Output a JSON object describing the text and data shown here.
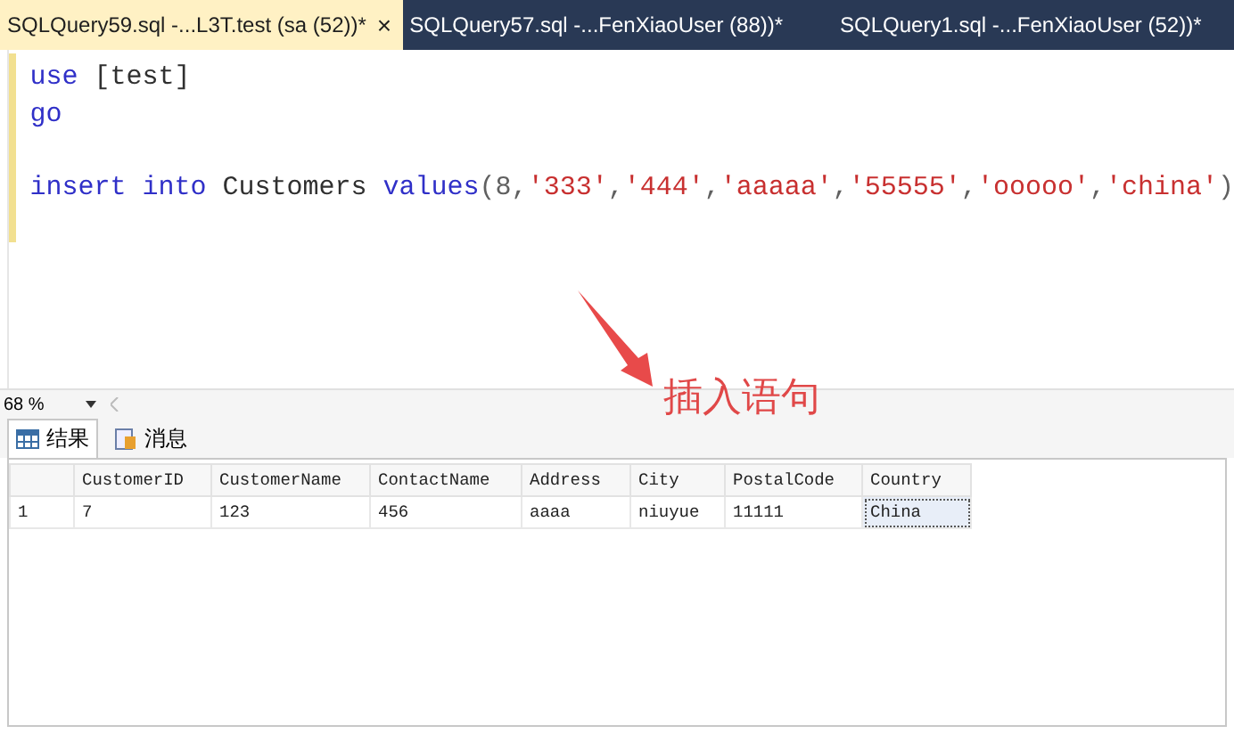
{
  "tabs": [
    {
      "label": "SQLQuery59.sql -...L3T.test (sa (52))*",
      "selected": true,
      "close": "×"
    },
    {
      "label": "SQLQuery57.sql -...FenXiaoUser (88))*",
      "selected": false
    },
    {
      "label": "SQLQuery1.sql -...FenXiaoUser (52))*",
      "selected": false
    }
  ],
  "editor": {
    "lines": [
      {
        "kind": "code",
        "tokens": [
          {
            "text": "use",
            "kind": "keyword"
          },
          {
            "text": " [test]",
            "kind": "plain"
          }
        ]
      },
      {
        "kind": "code",
        "tokens": [
          {
            "text": "go",
            "kind": "keyword"
          }
        ]
      },
      {
        "kind": "blank"
      },
      {
        "kind": "code",
        "tokens": [
          {
            "text": "insert",
            "kind": "keyword"
          },
          {
            "text": " into",
            "kind": "keyword"
          },
          {
            "text": " Customers ",
            "kind": "plain"
          },
          {
            "text": "values",
            "kind": "keyword"
          },
          {
            "text": "(8,",
            "kind": "punct"
          },
          {
            "text": "'333'",
            "kind": "string"
          },
          {
            "text": ",",
            "kind": "punct"
          },
          {
            "text": "'444'",
            "kind": "string"
          },
          {
            "text": ",",
            "kind": "punct"
          },
          {
            "text": "'aaaaa'",
            "kind": "string"
          },
          {
            "text": ",",
            "kind": "punct"
          },
          {
            "text": "'55555'",
            "kind": "string"
          },
          {
            "text": ",",
            "kind": "punct"
          },
          {
            "text": "'ooooo'",
            "kind": "string"
          },
          {
            "text": ",",
            "kind": "punct"
          },
          {
            "text": "'china'",
            "kind": "string"
          },
          {
            "text": ")",
            "kind": "punct"
          }
        ]
      }
    ]
  },
  "annotation": {
    "text": "插入语句"
  },
  "zoom": {
    "value": "68 %"
  },
  "result_tabs": [
    {
      "label": "结果",
      "kind": "grid",
      "selected": true
    },
    {
      "label": "消息",
      "kind": "message",
      "selected": false
    }
  ],
  "table": {
    "columns": [
      "CustomerID",
      "CustomerName",
      "ContactName",
      "Address",
      "City",
      "PostalCode",
      "Country"
    ],
    "rows": [
      {
        "number": "1",
        "cells": [
          {
            "text": "7",
            "selected": false
          },
          {
            "text": "123",
            "selected": false
          },
          {
            "text": "456",
            "selected": false
          },
          {
            "text": "aaaa",
            "selected": false
          },
          {
            "text": "niuyue",
            "selected": false
          },
          {
            "text": "11111",
            "selected": false
          },
          {
            "text": "China",
            "selected": true
          }
        ]
      }
    ]
  }
}
